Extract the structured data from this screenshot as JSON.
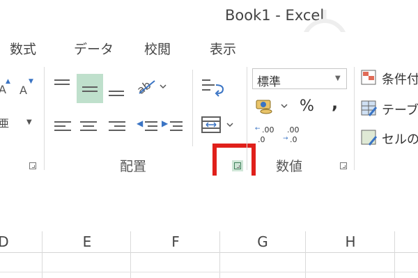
{
  "window": {
    "title": "Book1 - Excel"
  },
  "tabs": [
    {
      "label": "数式"
    },
    {
      "label": "データ"
    },
    {
      "label": "校閲"
    },
    {
      "label": "表示"
    }
  ],
  "ribbon": {
    "font_group": {
      "a_large": "A",
      "a_small": "A",
      "furigana": "亜"
    },
    "alignment_group": {
      "label": "配置"
    },
    "number_group": {
      "label": "数値",
      "format_value": "標準",
      "percent": "%",
      "comma": ",",
      "inc_decimal": ".00",
      "dec_decimal": ".00"
    },
    "styles_group": {
      "conditional": "条件付",
      "table": "テーブ",
      "cell": "セルの"
    }
  },
  "columns": [
    "D",
    "E",
    "F",
    "G",
    "H"
  ],
  "colors": {
    "highlight_box": "#e0201b",
    "selected_button": "#bfe0cc",
    "text": "#444444"
  }
}
